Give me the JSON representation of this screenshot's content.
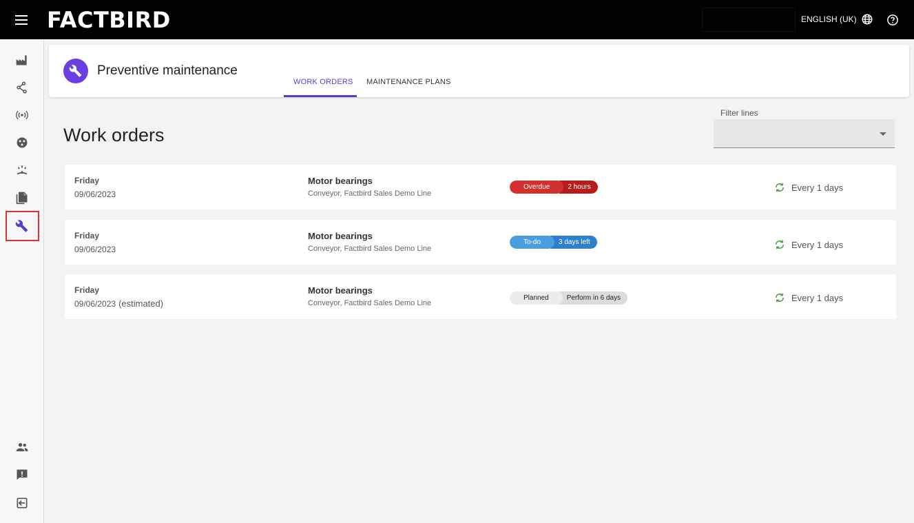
{
  "app": {
    "logo": "FACTBIRD",
    "language": "ENGLISH (UK)"
  },
  "header": {
    "title": "Preventive maintenance",
    "tabs": [
      {
        "label": "WORK ORDERS"
      },
      {
        "label": "MAINTENANCE PLANS"
      }
    ],
    "accent": "#5b3dc8"
  },
  "main": {
    "title": "Work orders",
    "filter": {
      "label": "Filter lines",
      "value": ""
    },
    "orders": [
      {
        "day": "Friday",
        "date": "09/06/2023",
        "estimated": "",
        "task": "Motor bearings",
        "location": "Conveyor, Factbird Sales Demo Line",
        "status": "Overdue",
        "status_detail": "2 hours",
        "status_color": "#d32f2f",
        "detail_color": "#b71c1c",
        "text_color": "#ffffff",
        "recurrence": "Every 1 days"
      },
      {
        "day": "Friday",
        "date": "09/06/2023",
        "estimated": "",
        "task": "Motor bearings",
        "location": "Conveyor, Factbird Sales Demo Line",
        "status": "To-do",
        "status_detail": "3 days left",
        "status_color": "#4a9ee0",
        "detail_color": "#2f7fcf",
        "text_color": "#ffffff",
        "recurrence": "Every 1 days"
      },
      {
        "day": "Friday",
        "date": "09/06/2023",
        "estimated": "(estimated)",
        "task": "Motor bearings",
        "location": "Conveyor, Factbird Sales Demo Line",
        "status": "Planned",
        "status_detail": "Perform in 6 days",
        "status_color": "#ececec",
        "detail_color": "#dcdcdc",
        "text_color": "#222222",
        "recurrence": "Every 1 days"
      }
    ]
  }
}
